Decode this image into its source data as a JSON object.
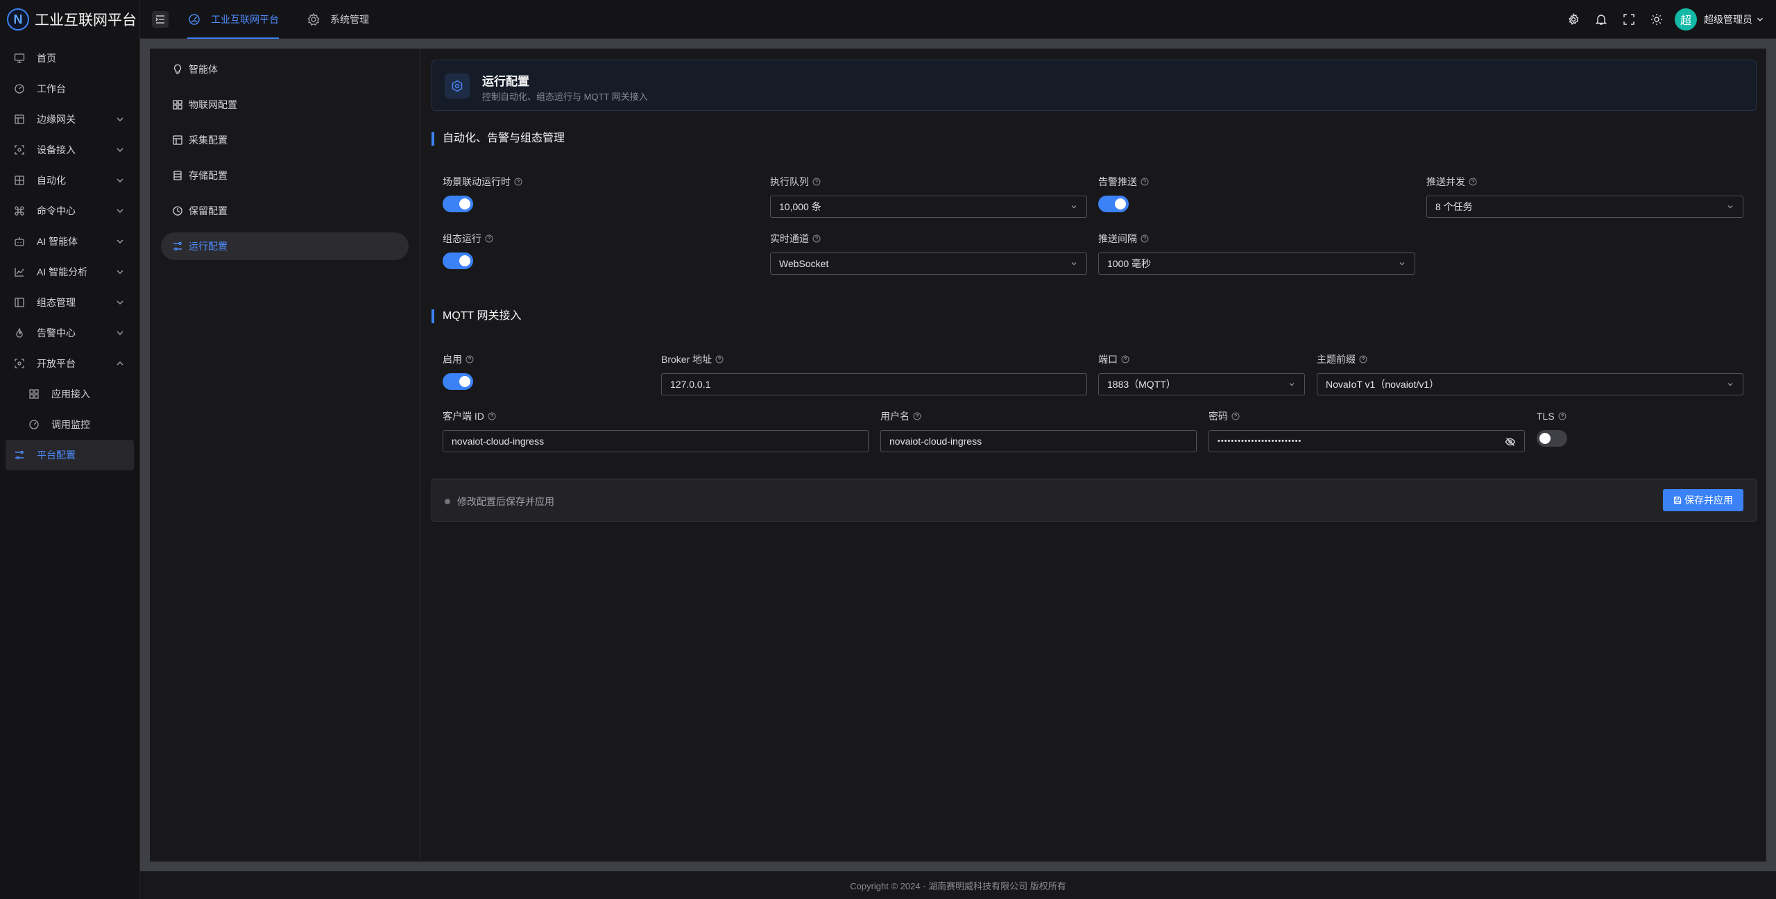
{
  "app": {
    "title": "工业互联网平台",
    "logo_letter": "N"
  },
  "sidebar": {
    "items": [
      {
        "label": "首页",
        "icon": "monitor-icon"
      },
      {
        "label": "工作台",
        "icon": "dashboard-icon"
      },
      {
        "label": "边缘网关",
        "icon": "layout-icon",
        "expandable": true
      },
      {
        "label": "设备接入",
        "icon": "scan-icon",
        "expandable": true
      },
      {
        "label": "自动化",
        "icon": "grid-icon",
        "expandable": true
      },
      {
        "label": "命令中心",
        "icon": "command-icon",
        "expandable": true
      },
      {
        "label": "AI 智能体",
        "icon": "bot-icon",
        "expandable": true
      },
      {
        "label": "AI 智能分析",
        "icon": "chart-icon",
        "expandable": true
      },
      {
        "label": "组态管理",
        "icon": "panel-icon",
        "expandable": true
      },
      {
        "label": "告警中心",
        "icon": "flame-icon",
        "expandable": true
      },
      {
        "label": "开放平台",
        "icon": "scan-icon",
        "expandable": true,
        "expanded": true
      },
      {
        "label": "应用接入",
        "icon": "apps-icon",
        "sub": true
      },
      {
        "label": "调用监控",
        "icon": "monitor-gauge-icon",
        "sub": true
      },
      {
        "label": "平台配置",
        "icon": "sliders-icon",
        "active": true
      }
    ]
  },
  "topbar": {
    "tabs": [
      {
        "label": "工业互联网平台",
        "icon": "cloud-icon",
        "active": true
      },
      {
        "label": "系统管理",
        "icon": "gear-icon"
      }
    ],
    "user": {
      "avatar": "超",
      "name": "超级管理员"
    }
  },
  "subnav": {
    "items": [
      {
        "label": "智能体",
        "icon": "bulb-icon"
      },
      {
        "label": "物联网配置",
        "icon": "apps-icon"
      },
      {
        "label": "采集配置",
        "icon": "layout-icon"
      },
      {
        "label": "存储配置",
        "icon": "database-icon"
      },
      {
        "label": "保留配置",
        "icon": "clock-icon"
      },
      {
        "label": "运行配置",
        "icon": "sliders-icon",
        "active": true
      }
    ]
  },
  "hero": {
    "title": "运行配置",
    "subtitle": "控制自动化、组态运行与 MQTT 网关接入"
  },
  "section1": {
    "title": "自动化、告警与组态管理",
    "scene_runtime": {
      "label": "场景联动运行时",
      "on": true
    },
    "exec_queue": {
      "label": "执行队列",
      "value": "10,000 条"
    },
    "alarm_push": {
      "label": "告警推送",
      "on": true
    },
    "push_concurrency": {
      "label": "推送并发",
      "value": "8 个任务"
    },
    "scada_run": {
      "label": "组态运行",
      "on": true
    },
    "realtime_channel": {
      "label": "实时通道",
      "value": "WebSocket"
    },
    "push_interval": {
      "label": "推送间隔",
      "value": "1000 毫秒"
    }
  },
  "section2": {
    "title": "MQTT 网关接入",
    "enable": {
      "label": "启用",
      "on": true
    },
    "broker": {
      "label": "Broker 地址",
      "value": "127.0.0.1"
    },
    "port": {
      "label": "端口",
      "value": "1883（MQTT）"
    },
    "topic_prefix": {
      "label": "主题前缀",
      "value": "NovaIoT v1（novaiot/v1）"
    },
    "client_id": {
      "label": "客户端 ID",
      "value": "novaiot-cloud-ingress"
    },
    "username": {
      "label": "用户名",
      "value": "novaiot-cloud-ingress"
    },
    "password": {
      "label": "密码",
      "value": "•••••••••••••••••••••••••"
    },
    "tls": {
      "label": "TLS",
      "on": false
    }
  },
  "savebar": {
    "hint": "修改配置后保存并应用",
    "button": "保存并应用"
  },
  "footer": {
    "text": "Copyright © 2024 - 湖南赛明威科技有限公司 版权所有"
  },
  "colors": {
    "accent": "#3b82f6",
    "background": "#18181b",
    "avatar": "#14b8a6"
  }
}
